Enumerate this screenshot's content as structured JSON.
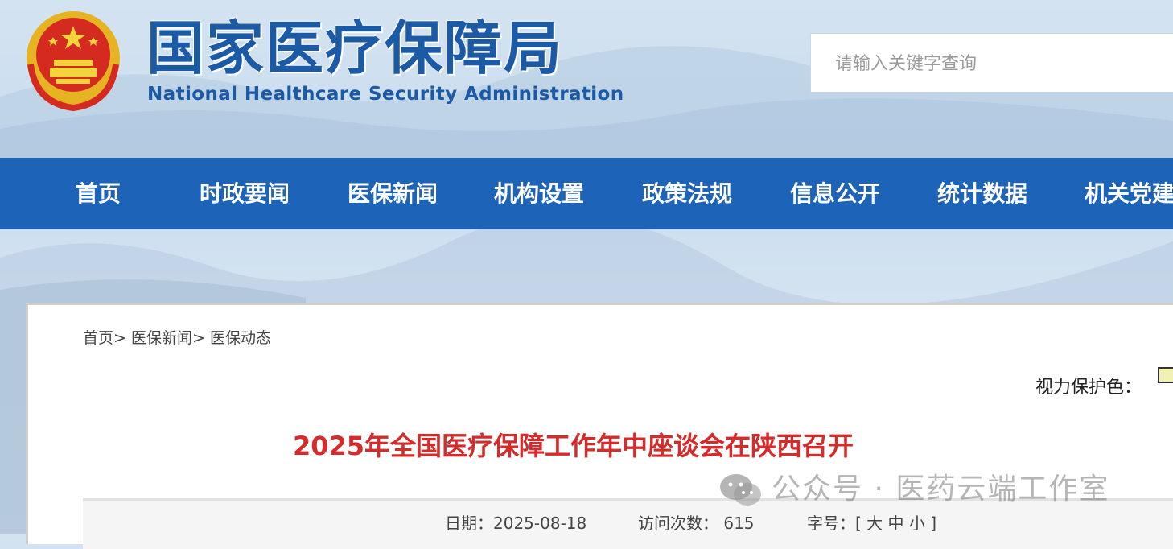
{
  "header": {
    "title_cn": "国家医疗保障局",
    "title_en": "National Healthcare Security Administration"
  },
  "search": {
    "placeholder": "请输入关键字查询"
  },
  "nav": {
    "items": [
      "首页",
      "时政要闻",
      "医保新闻",
      "机构设置",
      "政策法规",
      "信息公开",
      "统计数据",
      "机关党建"
    ]
  },
  "breadcrumb": {
    "home": "首页>",
    "news": "医保新闻>",
    "current": "医保动态"
  },
  "protect": {
    "label": "视力保护色："
  },
  "article": {
    "title": "2025年全国医疗保障工作年中座谈会在陕西召开",
    "date": "日期：2025-08-18",
    "visits": "访问次数： 615",
    "font_size": "字号：[ 大 中 小 ]"
  },
  "watermark": {
    "text": "公众号 · 医药云端工作室"
  },
  "colors": {
    "nav_bg": "#1d63b8",
    "title_red": "#d62b2b",
    "logo_blue": "#1a5aa6"
  }
}
